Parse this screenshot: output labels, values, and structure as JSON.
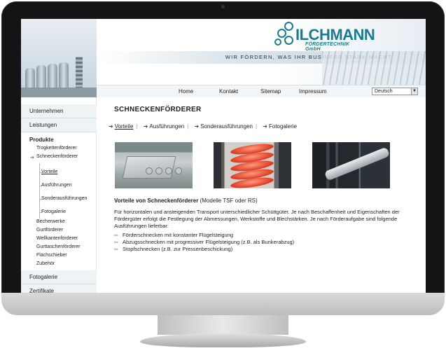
{
  "header": {
    "logo_text": "ILCHMANN",
    "logo_subtext": "FÖRDERTECHNIK GmbH",
    "tagline": "WIR FÖRDERN, WAS IHR BUSINESS STARK MACHT"
  },
  "nav": {
    "items": [
      "Home",
      "Kontakt",
      "Sitemap",
      "Impressum"
    ],
    "language": "Deutsch"
  },
  "sidebar": {
    "top_items": [
      "Unternehmen",
      "Leistungen"
    ],
    "section_title": "Produkte",
    "products": [
      "Trogkettenförderer",
      "Schneckenförderer"
    ],
    "screw_subitems": [
      "Vorteile",
      "Ausführungen",
      "Sonderausführungen",
      "Fotogalerie"
    ],
    "more_products": [
      "Becherwerke",
      "Gurtförderer",
      "Wellkantenförderer",
      "Gurttaschenförderer",
      "Flachschieber",
      "Zubehör"
    ],
    "bottom_items": [
      "Fotogalerie",
      "Zertifikate"
    ]
  },
  "content": {
    "title": "SCHNECKENFÖRDERER",
    "subnav": [
      "Vorteile",
      "Ausführungen",
      "Sonderausführungen",
      "Fotogalerie"
    ],
    "intro_bold": "Vorteile von Schneckenförderer",
    "intro_rest": " (Modelle TSF oder RS)",
    "paragraph": "Für horizontalen und ansteigenden Transport unterschiedlicher Schüttgüter. Je nach Beschaffenheit und Eigenschaften der Fördergüter erfolgt die Festlegung der Abmessungen, Werkstoffe und Blechstärken. Je nach Förderaufgabe sind folgende Ausführungen lieferbar:",
    "bullets": [
      "Förderschnecken mit konstanter Flügelsteigung",
      "Abzugsschnecken mit progressiver Flügelsteigung (z.B. als Bunkerabzug)",
      "Stopfschnecken (z.B. zur Pressenbeschickung)"
    ]
  },
  "colors": {
    "brand": "#1b7b8e",
    "sidebar_bg": "#eef3f6"
  }
}
